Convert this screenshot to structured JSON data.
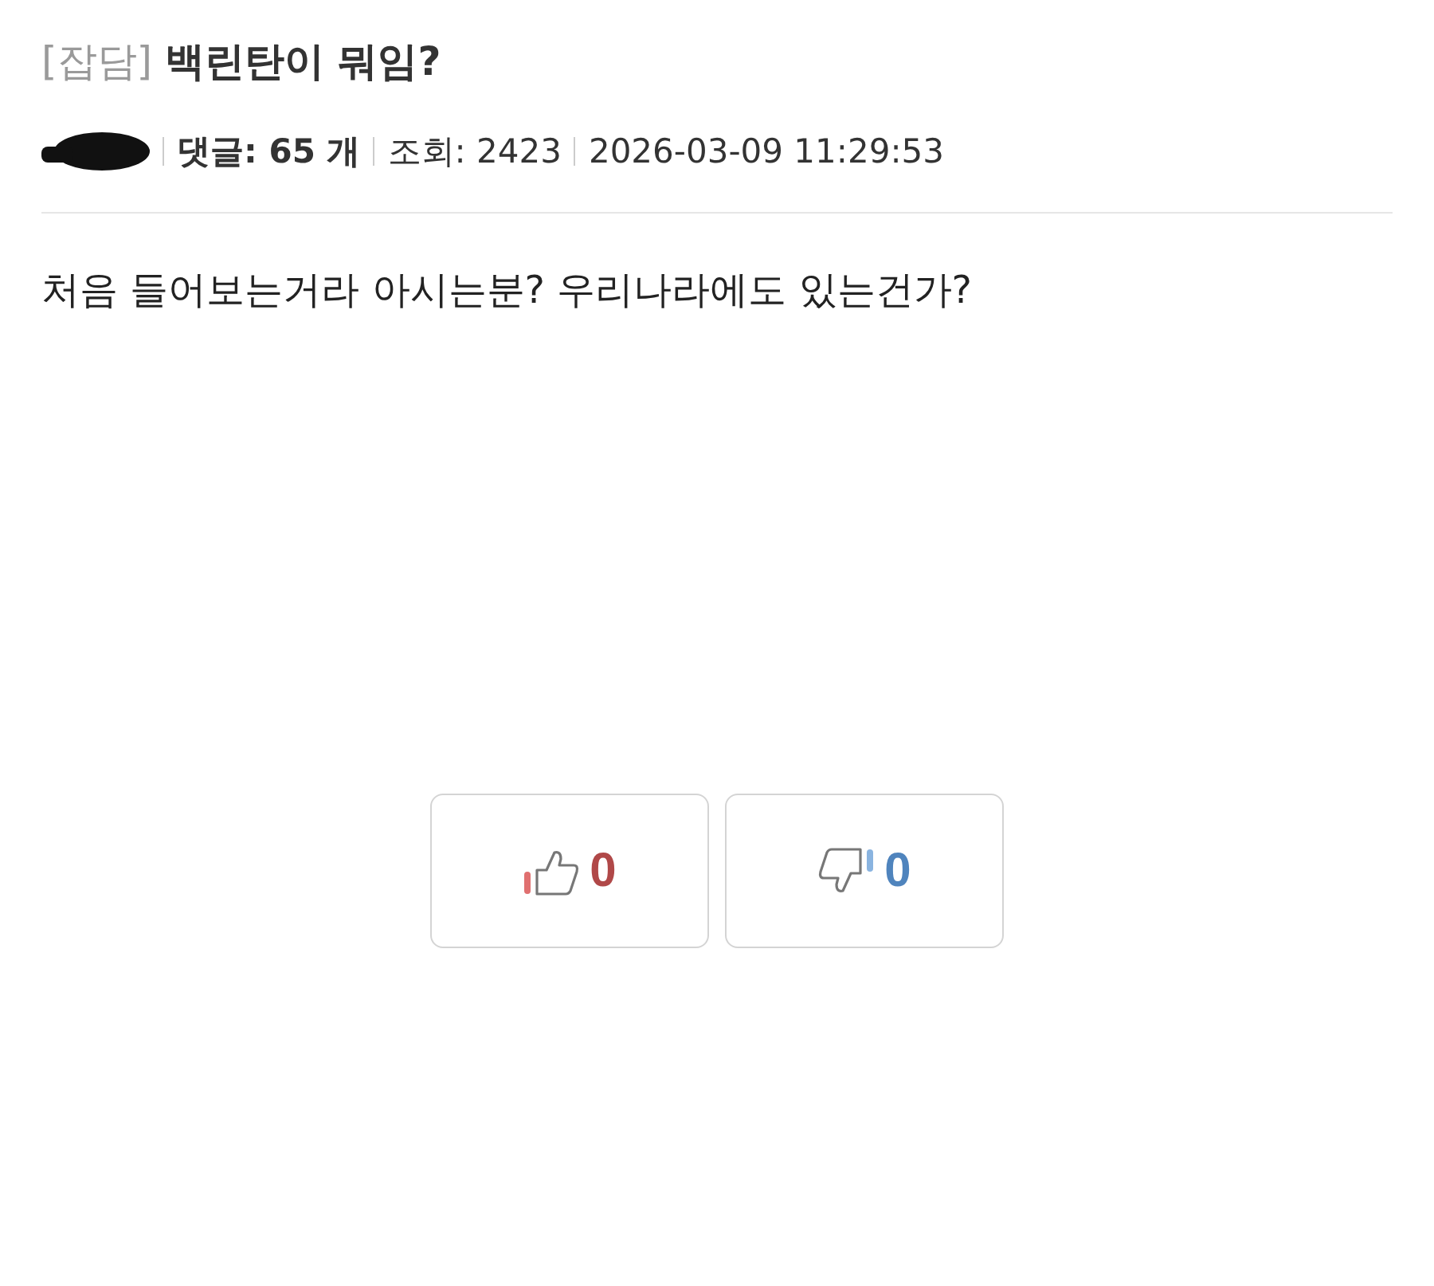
{
  "post": {
    "category": "[잡담]",
    "title": "백린탄이 뭐임?"
  },
  "meta": {
    "comments_label": "댓글: 65 개",
    "views": "조회: 2423",
    "date": "2026-03-09 11:29:53"
  },
  "body": "처음 들어보는거라 아시는분? 우리나라에도 있는건가?",
  "votes": [
    {
      "kind": "up",
      "count": "0"
    },
    {
      "kind": "down",
      "count": "0"
    }
  ]
}
